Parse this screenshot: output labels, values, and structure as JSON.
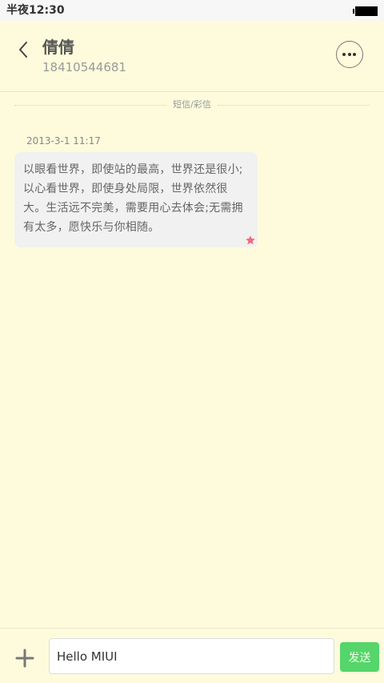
{
  "status_bar": {
    "time": "半夜12:30"
  },
  "header": {
    "contact_name": "倩倩",
    "contact_number": "18410544681",
    "icons": {
      "back": "chevron-left-icon",
      "more": "more-horizontal-icon"
    }
  },
  "conversation": {
    "divider_label": "短信/彩信",
    "messages": [
      {
        "timestamp": "2013-3-1 11:17",
        "text": "以眼看世界，即使站的最高，世界还是很小;以心看世界，即使身处局限，世界依然很大。生活远不完美，需要用心去体会;无需拥有太多，愿快乐与你相随。",
        "starred": true
      }
    ]
  },
  "composer": {
    "input_value": "Hello MIUI",
    "send_label": "发送",
    "icons": {
      "attach": "plus-icon"
    }
  },
  "colors": {
    "background": "#fdfbdc",
    "bubble": "#f1f1f1",
    "send_button": "#55d56a",
    "star": "#f06a7a"
  }
}
